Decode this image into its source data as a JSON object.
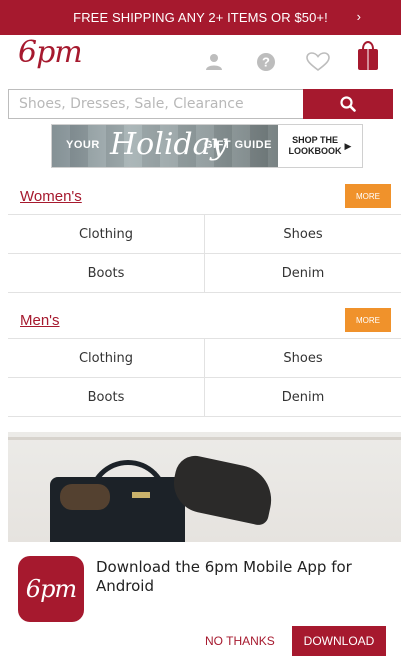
{
  "promo": {
    "text": "FREE SHIPPING ANY 2+ ITEMS OR $50+!",
    "arrow": "›"
  },
  "header": {
    "logo": "6pm",
    "icons": [
      "user-icon",
      "help-icon",
      "heart-icon",
      "shopping-bag-icon"
    ]
  },
  "search": {
    "placeholder": "Shoes, Dresses, Sale, Clearance",
    "button_icon": "search-icon"
  },
  "banner": {
    "your": "YOUR",
    "holiday": "Holiday",
    "gift_guide": "GIFT GUIDE",
    "shop_cta": "SHOP THE\nLOOKBOOK",
    "shop_arrow": "▶"
  },
  "womens": {
    "title": "Women's",
    "more": "MORE",
    "rows": [
      [
        "Clothing",
        "Shoes"
      ],
      [
        "Boots",
        "Denim"
      ]
    ]
  },
  "mens": {
    "title": "Men's",
    "more": "MORE",
    "rows": [
      [
        "Clothing",
        "Shoes"
      ],
      [
        "Boots",
        "Denim"
      ]
    ]
  },
  "app_banner": {
    "icon_text": "6pm",
    "message": "Download the 6pm Mobile App for Android",
    "no_thanks": "NO THANKS",
    "download": "DOWNLOAD"
  },
  "colors": {
    "brand": "#a6192e",
    "more_button": "#f0922b"
  }
}
